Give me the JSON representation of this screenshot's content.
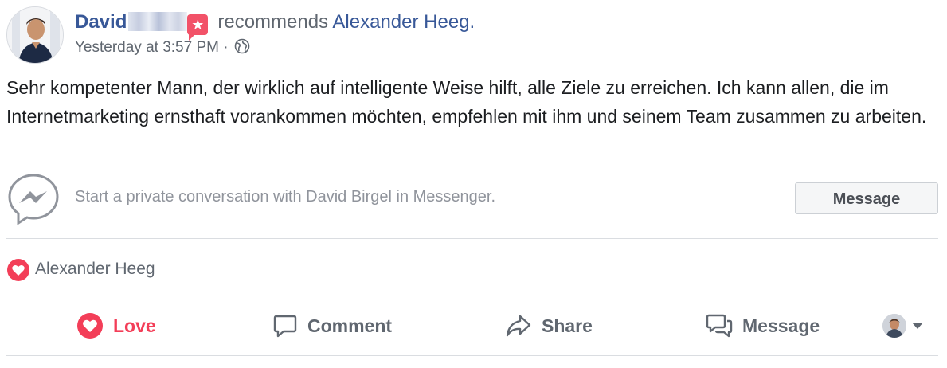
{
  "post": {
    "author_first_name": "David",
    "verb": "recommends",
    "target": "Alexander Heeg.",
    "timestamp": "Yesterday at 3:57 PM",
    "separator": "·",
    "body": "Sehr kompetenter Mann, der wirklich auf intelligente Weise hilft, alle Ziele zu erreichen. Ich kann allen, die im Internetmarketing ernsthaft vorankommen möchten, empfehlen mit ihm und seinem Team zusammen zu arbeiten."
  },
  "messenger": {
    "prompt": "Start a private conversation with David Birgel in Messenger.",
    "button_label": "Message"
  },
  "reactions": {
    "name": "Alexander Heeg"
  },
  "actions": {
    "love": "Love",
    "comment": "Comment",
    "share": "Share",
    "message": "Message"
  },
  "colors": {
    "link": "#385898",
    "secondary_text": "#606770",
    "love": "#f33e58",
    "divider": "#dadde1"
  },
  "icons": [
    "recommendation-badge-icon",
    "globe-icon",
    "messenger-icon",
    "love-reaction-icon",
    "love-icon",
    "comment-icon",
    "share-icon",
    "message-icon",
    "viewer-avatar",
    "chevron-down-icon"
  ]
}
